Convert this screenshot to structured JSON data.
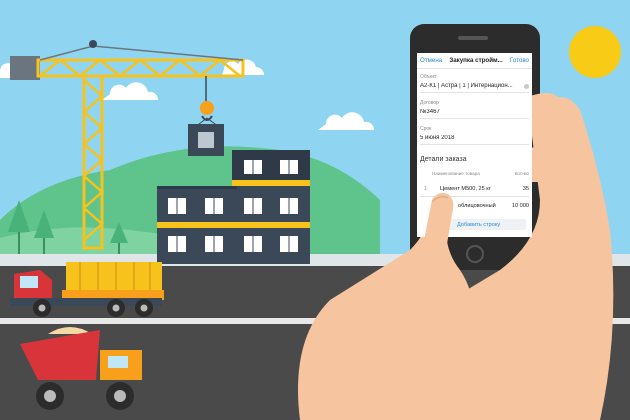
{
  "nav": {
    "cancel": "Отмена",
    "title": "Закупка стройм...",
    "done": "Готово"
  },
  "fields": {
    "object_label": "Объект",
    "object_value": "А2-К1 | Астра | 1 | Интернацион...",
    "contract_label": "Договор",
    "contract_value": "№3467",
    "date_label": "Срок",
    "date_value": "5 июня 2018"
  },
  "details": {
    "heading": "Детали заказа",
    "col_name": "Наименование товара",
    "col_qty": "Кол-во",
    "rows": [
      {
        "num": "1",
        "name": "Цемент М500, 25 кг",
        "qty": "35"
      },
      {
        "num": "",
        "name": "облицовочный",
        "qty": "10 000"
      }
    ],
    "add_row": "Добавить строку"
  },
  "colors": {
    "sky": "#8fd5f1",
    "grass": "#5ec48b",
    "road": "#4a4a4a",
    "crane": "#f8c21c",
    "building": "#3b4858",
    "sun": "#f8cb16",
    "phone": "#2c2c2c",
    "hand": "#f6c59f",
    "link": "#2b8bd8"
  },
  "icons": [
    "crane-icon",
    "sun-icon",
    "building-icon",
    "truck-icon",
    "dump-truck-icon",
    "tree-icon",
    "hand-icon",
    "phone-icon",
    "clear-icon"
  ]
}
